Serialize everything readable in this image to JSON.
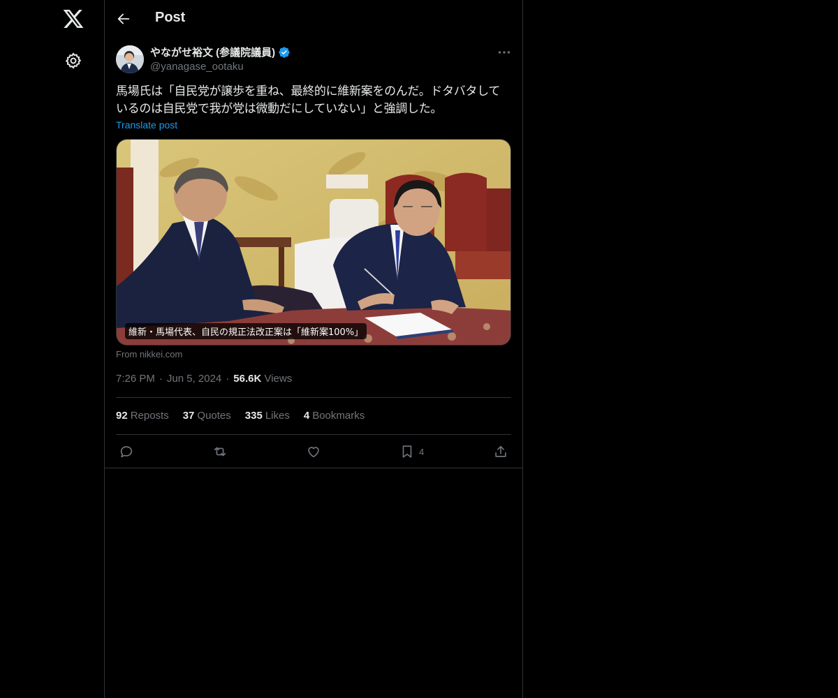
{
  "nav": {
    "logo_icon": "x-logo-icon",
    "settings_icon": "gear-icon"
  },
  "header": {
    "title": "Post",
    "back_icon": "arrow-left-icon"
  },
  "post": {
    "author": {
      "name": "やながせ裕文 (参議院議員)",
      "handle": "@yanagase_ootaku",
      "verified": true
    },
    "text": "馬場氏は「自民党が譲歩を重ね、最終的に維新案をのんだ。ドタバタしているのは自民党で我が党は微動だにしていない」と強調した。",
    "translate_label": "Translate post",
    "media": {
      "caption": "維新・馬場代表、自民の規正法改正案は「維新案100%」",
      "source": "From nikkei.com"
    },
    "time": "7:26 PM",
    "date": "Jun 5, 2024",
    "views_count": "56.6K",
    "views_label": "Views",
    "stats": [
      {
        "count": "92",
        "label": "Reposts"
      },
      {
        "count": "37",
        "label": "Quotes"
      },
      {
        "count": "335",
        "label": "Likes"
      },
      {
        "count": "4",
        "label": "Bookmarks"
      }
    ],
    "actions": {
      "reply_icon": "reply-icon",
      "repost_icon": "repost-icon",
      "like_icon": "heart-icon",
      "bookmark_icon": "bookmark-icon",
      "bookmark_count": "4",
      "share_icon": "share-icon"
    }
  },
  "colors": {
    "background": "#000000",
    "text": "#e7e9ea",
    "muted": "#71767b",
    "accent": "#1d9bf0",
    "border": "#2f3336"
  }
}
